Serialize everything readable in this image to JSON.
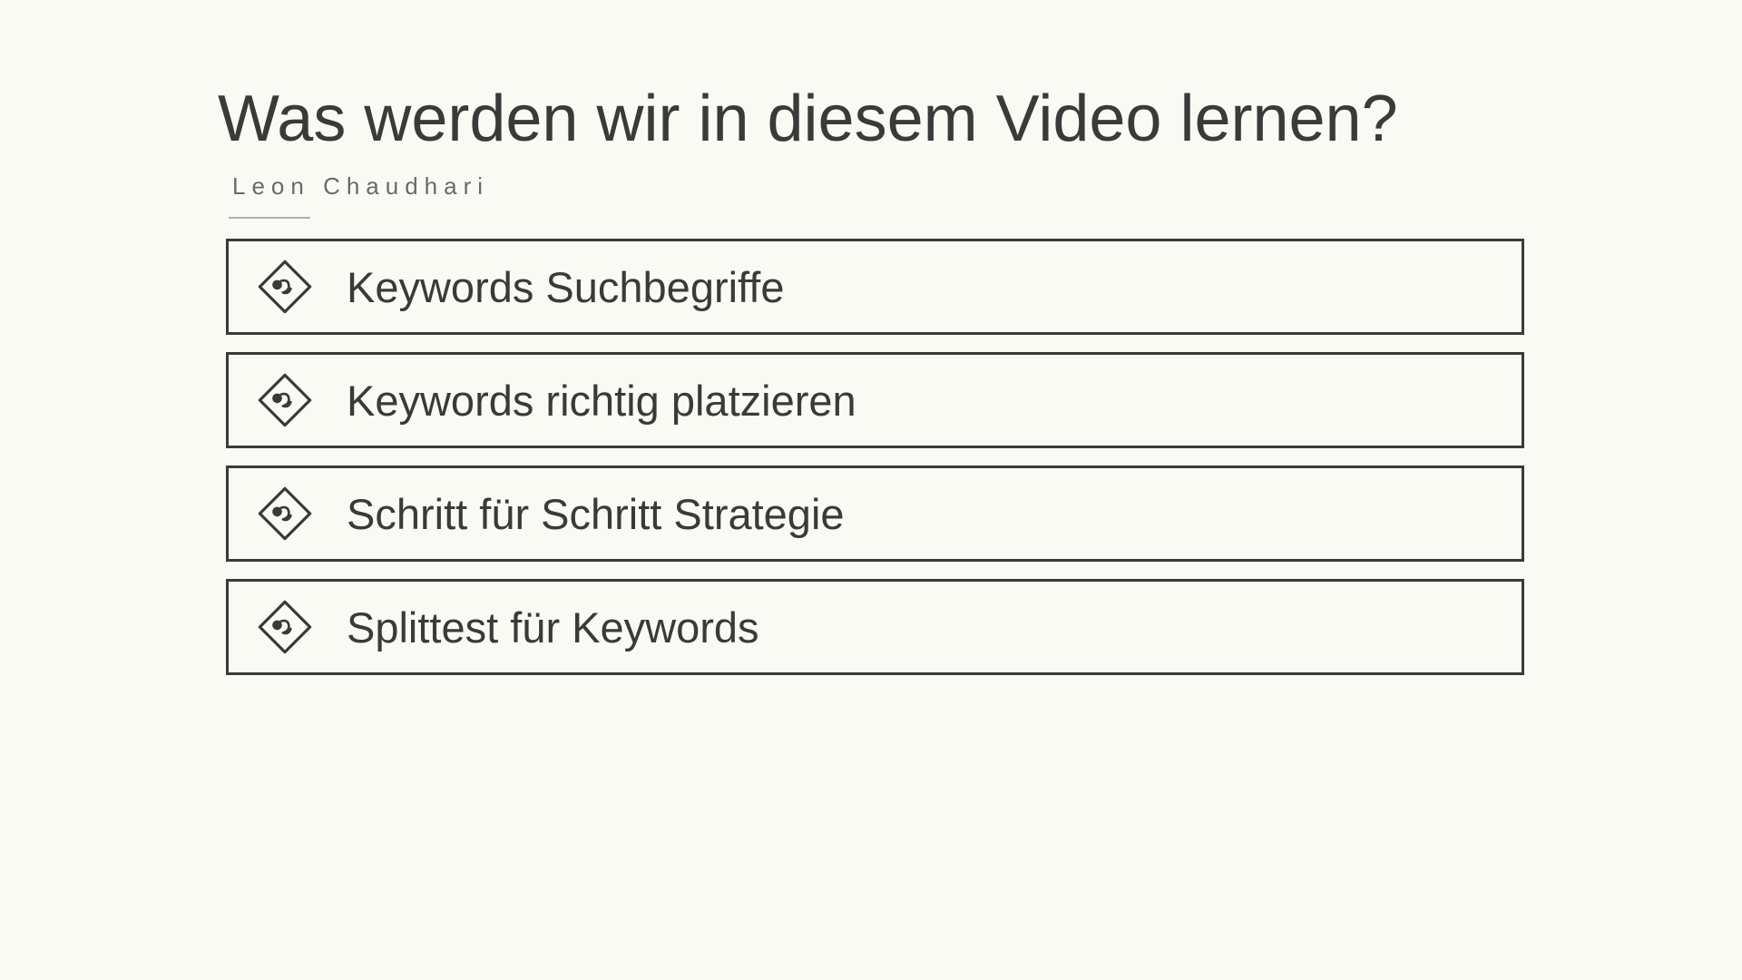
{
  "title": "Was werden wir in diesem Video lernen?",
  "author": "Leon Chaudhari",
  "items": [
    {
      "label": "Keywords Suchbegriffe"
    },
    {
      "label": "Keywords richtig platzieren"
    },
    {
      "label": "Schritt für Schritt Strategie"
    },
    {
      "label": "Splittest für Keywords"
    }
  ]
}
